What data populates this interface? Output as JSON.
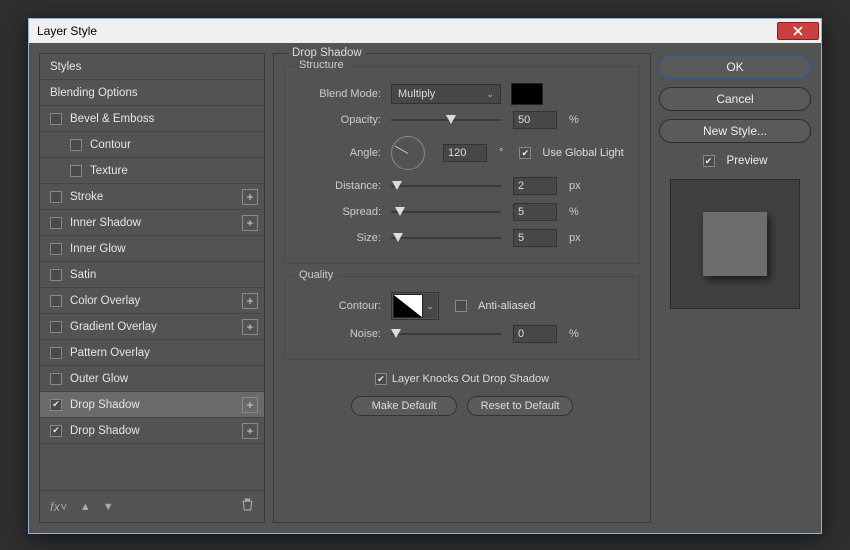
{
  "window": {
    "title": "Layer Style"
  },
  "left": {
    "header_styles": "Styles",
    "header_blending": "Blending Options",
    "items": [
      {
        "label": "Bevel & Emboss",
        "checked": false,
        "indent": 0,
        "plus": false
      },
      {
        "label": "Contour",
        "checked": false,
        "indent": 1,
        "plus": false
      },
      {
        "label": "Texture",
        "checked": false,
        "indent": 1,
        "plus": false
      },
      {
        "label": "Stroke",
        "checked": false,
        "indent": 0,
        "plus": true
      },
      {
        "label": "Inner Shadow",
        "checked": false,
        "indent": 0,
        "plus": true
      },
      {
        "label": "Inner Glow",
        "checked": false,
        "indent": 0,
        "plus": false
      },
      {
        "label": "Satin",
        "checked": false,
        "indent": 0,
        "plus": false
      },
      {
        "label": "Color Overlay",
        "checked": false,
        "indent": 0,
        "plus": true
      },
      {
        "label": "Gradient Overlay",
        "checked": false,
        "indent": 0,
        "plus": true
      },
      {
        "label": "Pattern Overlay",
        "checked": false,
        "indent": 0,
        "plus": false
      },
      {
        "label": "Outer Glow",
        "checked": false,
        "indent": 0,
        "plus": false
      },
      {
        "label": "Drop Shadow",
        "checked": true,
        "indent": 0,
        "plus": true,
        "selected": true
      },
      {
        "label": "Drop Shadow",
        "checked": true,
        "indent": 0,
        "plus": true
      }
    ]
  },
  "mid": {
    "title": "Drop Shadow",
    "structure_title": "Structure",
    "quality_title": "Quality",
    "blend_mode_label": "Blend Mode:",
    "blend_mode_value": "Multiply",
    "shadow_color": "#000000",
    "opacity_label": "Opacity:",
    "opacity_value": "50",
    "opacity_unit": "%",
    "angle_label": "Angle:",
    "angle_value": "120",
    "angle_unit": "°",
    "use_global_light_label": "Use Global Light",
    "use_global_light_checked": true,
    "distance_label": "Distance:",
    "distance_value": "2",
    "distance_unit": "px",
    "spread_label": "Spread:",
    "spread_value": "5",
    "spread_unit": "%",
    "size_label": "Size:",
    "size_value": "5",
    "size_unit": "px",
    "contour_label": "Contour:",
    "antialiased_label": "Anti-aliased",
    "antialiased_checked": false,
    "noise_label": "Noise:",
    "noise_value": "0",
    "noise_unit": "%",
    "knockout_label": "Layer Knocks Out Drop Shadow",
    "knockout_checked": true,
    "make_default": "Make Default",
    "reset_default": "Reset to Default"
  },
  "right": {
    "ok": "OK",
    "cancel": "Cancel",
    "new_style": "New Style...",
    "preview_label": "Preview",
    "preview_checked": true
  }
}
